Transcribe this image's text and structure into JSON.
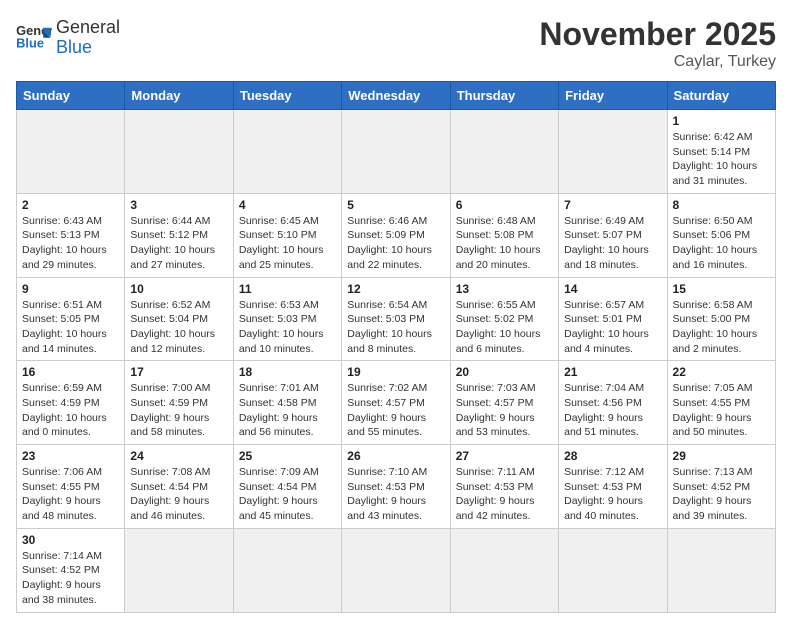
{
  "header": {
    "title": "November 2025",
    "location": "Caylar, Turkey",
    "logo_general": "General",
    "logo_blue": "Blue"
  },
  "weekdays": [
    "Sunday",
    "Monday",
    "Tuesday",
    "Wednesday",
    "Thursday",
    "Friday",
    "Saturday"
  ],
  "days": [
    {
      "num": "",
      "sunrise": "",
      "sunset": "",
      "daylight": "",
      "empty": true
    },
    {
      "num": "",
      "sunrise": "",
      "sunset": "",
      "daylight": "",
      "empty": true
    },
    {
      "num": "",
      "sunrise": "",
      "sunset": "",
      "daylight": "",
      "empty": true
    },
    {
      "num": "",
      "sunrise": "",
      "sunset": "",
      "daylight": "",
      "empty": true
    },
    {
      "num": "",
      "sunrise": "",
      "sunset": "",
      "daylight": "",
      "empty": true
    },
    {
      "num": "",
      "sunrise": "",
      "sunset": "",
      "daylight": "",
      "empty": true
    },
    {
      "num": "1",
      "sunrise": "Sunrise: 6:42 AM",
      "sunset": "Sunset: 5:14 PM",
      "daylight": "Daylight: 10 hours and 31 minutes."
    },
    {
      "num": "2",
      "sunrise": "Sunrise: 6:43 AM",
      "sunset": "Sunset: 5:13 PM",
      "daylight": "Daylight: 10 hours and 29 minutes."
    },
    {
      "num": "3",
      "sunrise": "Sunrise: 6:44 AM",
      "sunset": "Sunset: 5:12 PM",
      "daylight": "Daylight: 10 hours and 27 minutes."
    },
    {
      "num": "4",
      "sunrise": "Sunrise: 6:45 AM",
      "sunset": "Sunset: 5:10 PM",
      "daylight": "Daylight: 10 hours and 25 minutes."
    },
    {
      "num": "5",
      "sunrise": "Sunrise: 6:46 AM",
      "sunset": "Sunset: 5:09 PM",
      "daylight": "Daylight: 10 hours and 22 minutes."
    },
    {
      "num": "6",
      "sunrise": "Sunrise: 6:48 AM",
      "sunset": "Sunset: 5:08 PM",
      "daylight": "Daylight: 10 hours and 20 minutes."
    },
    {
      "num": "7",
      "sunrise": "Sunrise: 6:49 AM",
      "sunset": "Sunset: 5:07 PM",
      "daylight": "Daylight: 10 hours and 18 minutes."
    },
    {
      "num": "8",
      "sunrise": "Sunrise: 6:50 AM",
      "sunset": "Sunset: 5:06 PM",
      "daylight": "Daylight: 10 hours and 16 minutes."
    },
    {
      "num": "9",
      "sunrise": "Sunrise: 6:51 AM",
      "sunset": "Sunset: 5:05 PM",
      "daylight": "Daylight: 10 hours and 14 minutes."
    },
    {
      "num": "10",
      "sunrise": "Sunrise: 6:52 AM",
      "sunset": "Sunset: 5:04 PM",
      "daylight": "Daylight: 10 hours and 12 minutes."
    },
    {
      "num": "11",
      "sunrise": "Sunrise: 6:53 AM",
      "sunset": "Sunset: 5:03 PM",
      "daylight": "Daylight: 10 hours and 10 minutes."
    },
    {
      "num": "12",
      "sunrise": "Sunrise: 6:54 AM",
      "sunset": "Sunset: 5:03 PM",
      "daylight": "Daylight: 10 hours and 8 minutes."
    },
    {
      "num": "13",
      "sunrise": "Sunrise: 6:55 AM",
      "sunset": "Sunset: 5:02 PM",
      "daylight": "Daylight: 10 hours and 6 minutes."
    },
    {
      "num": "14",
      "sunrise": "Sunrise: 6:57 AM",
      "sunset": "Sunset: 5:01 PM",
      "daylight": "Daylight: 10 hours and 4 minutes."
    },
    {
      "num": "15",
      "sunrise": "Sunrise: 6:58 AM",
      "sunset": "Sunset: 5:00 PM",
      "daylight": "Daylight: 10 hours and 2 minutes."
    },
    {
      "num": "16",
      "sunrise": "Sunrise: 6:59 AM",
      "sunset": "Sunset: 4:59 PM",
      "daylight": "Daylight: 10 hours and 0 minutes."
    },
    {
      "num": "17",
      "sunrise": "Sunrise: 7:00 AM",
      "sunset": "Sunset: 4:59 PM",
      "daylight": "Daylight: 9 hours and 58 minutes."
    },
    {
      "num": "18",
      "sunrise": "Sunrise: 7:01 AM",
      "sunset": "Sunset: 4:58 PM",
      "daylight": "Daylight: 9 hours and 56 minutes."
    },
    {
      "num": "19",
      "sunrise": "Sunrise: 7:02 AM",
      "sunset": "Sunset: 4:57 PM",
      "daylight": "Daylight: 9 hours and 55 minutes."
    },
    {
      "num": "20",
      "sunrise": "Sunrise: 7:03 AM",
      "sunset": "Sunset: 4:57 PM",
      "daylight": "Daylight: 9 hours and 53 minutes."
    },
    {
      "num": "21",
      "sunrise": "Sunrise: 7:04 AM",
      "sunset": "Sunset: 4:56 PM",
      "daylight": "Daylight: 9 hours and 51 minutes."
    },
    {
      "num": "22",
      "sunrise": "Sunrise: 7:05 AM",
      "sunset": "Sunset: 4:55 PM",
      "daylight": "Daylight: 9 hours and 50 minutes."
    },
    {
      "num": "23",
      "sunrise": "Sunrise: 7:06 AM",
      "sunset": "Sunset: 4:55 PM",
      "daylight": "Daylight: 9 hours and 48 minutes."
    },
    {
      "num": "24",
      "sunrise": "Sunrise: 7:08 AM",
      "sunset": "Sunset: 4:54 PM",
      "daylight": "Daylight: 9 hours and 46 minutes."
    },
    {
      "num": "25",
      "sunrise": "Sunrise: 7:09 AM",
      "sunset": "Sunset: 4:54 PM",
      "daylight": "Daylight: 9 hours and 45 minutes."
    },
    {
      "num": "26",
      "sunrise": "Sunrise: 7:10 AM",
      "sunset": "Sunset: 4:53 PM",
      "daylight": "Daylight: 9 hours and 43 minutes."
    },
    {
      "num": "27",
      "sunrise": "Sunrise: 7:11 AM",
      "sunset": "Sunset: 4:53 PM",
      "daylight": "Daylight: 9 hours and 42 minutes."
    },
    {
      "num": "28",
      "sunrise": "Sunrise: 7:12 AM",
      "sunset": "Sunset: 4:53 PM",
      "daylight": "Daylight: 9 hours and 40 minutes."
    },
    {
      "num": "29",
      "sunrise": "Sunrise: 7:13 AM",
      "sunset": "Sunset: 4:52 PM",
      "daylight": "Daylight: 9 hours and 39 minutes."
    },
    {
      "num": "30",
      "sunrise": "Sunrise: 7:14 AM",
      "sunset": "Sunset: 4:52 PM",
      "daylight": "Daylight: 9 hours and 38 minutes."
    }
  ]
}
